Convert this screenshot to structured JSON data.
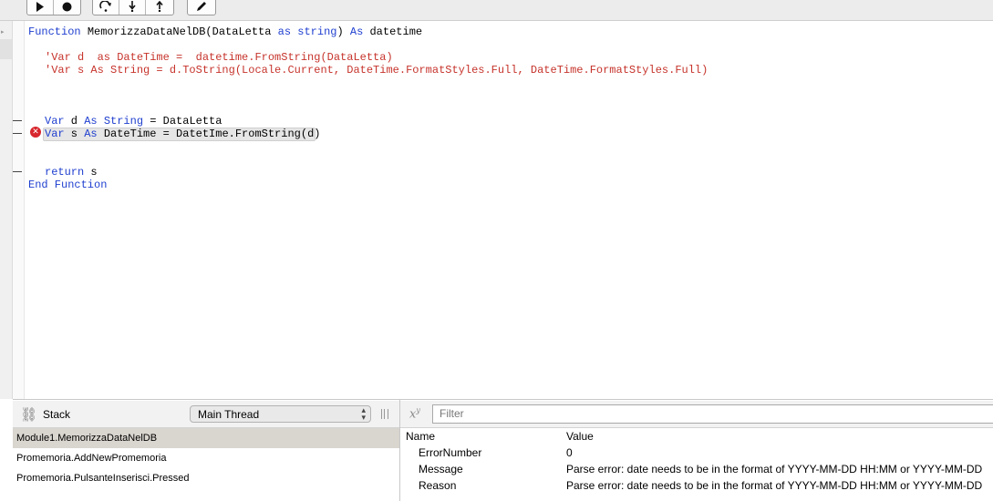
{
  "toolbar": {
    "run_group": [
      {
        "icon": "play-icon"
      },
      {
        "icon": "stop-icon"
      }
    ],
    "step_group": [
      {
        "icon": "step-over-icon"
      },
      {
        "icon": "step-into-icon"
      },
      {
        "icon": "step-out-icon"
      }
    ],
    "edit_group": [
      {
        "icon": "pencil-icon"
      }
    ]
  },
  "code": {
    "line1": {
      "kw1": "Function ",
      "name": "MemorizzaDataNelDB(DataLetta ",
      "kw2": "as string",
      "mid": ") ",
      "kw3": "As",
      "rest": " datetime"
    },
    "comment1": "'Var d  as DateTime =  datetime.FromString(DataLetta)",
    "comment2": "'Var s As String = d.ToString(Locale.Current, DateTime.FormatStyles.Full, DateTime.FormatStyles.Full)",
    "line4": {
      "kw1": "Var",
      "a": " d ",
      "kw2": "As",
      "b": " ",
      "kw3": "String",
      "rest": " = DataLetta"
    },
    "line5": {
      "kw1": "Var",
      "a": " s ",
      "kw2": "As",
      "b": " DateTime = DatetIme.FromString(d)"
    },
    "line6": {
      "kw1": "return",
      "rest": " s"
    },
    "line7": {
      "kw1": "End Function"
    }
  },
  "error_icon": "error-x-icon",
  "stack": {
    "title": "Stack",
    "thread_select": "Main Thread",
    "items": [
      {
        "label": "Module1.MemorizzaDataNelDB"
      },
      {
        "label": "Promemoria.AddNewPromemoria"
      },
      {
        "label": "Promemoria.PulsanteInserisci.Pressed"
      }
    ]
  },
  "variables": {
    "filter_placeholder": "Filter",
    "col_name": "Name",
    "col_value": "Value",
    "rows": [
      {
        "name": "ErrorNumber",
        "value": "0"
      },
      {
        "name": "Message",
        "value": "Parse error: date needs to be in the format of YYYY-MM-DD HH:MM or YYYY-MM-DD"
      },
      {
        "name": "Reason",
        "value": "Parse error: date needs to be in the format of YYYY-MM-DD HH:MM or YYYY-MM-DD"
      }
    ]
  },
  "colors": {
    "keyword": "#1f3fcf",
    "comment": "#c6332b",
    "error": "#d7262d",
    "active_row": "#d9d5cf"
  }
}
